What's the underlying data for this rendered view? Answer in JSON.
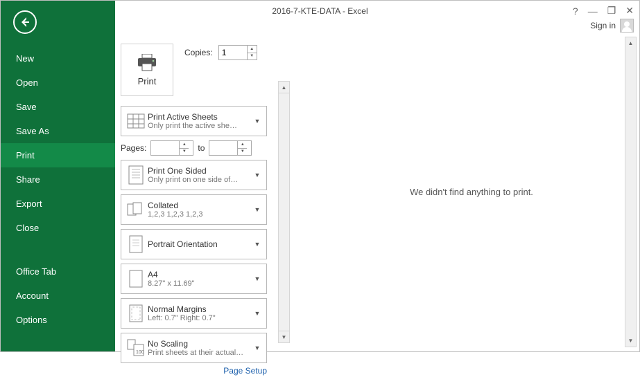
{
  "titlebar": {
    "title": "2016-7-KTE-DATA - Excel",
    "help_glyph": "?",
    "minimize_glyph": "—",
    "restore_glyph": "❐",
    "close_glyph": "✕",
    "signin_label": "Sign in"
  },
  "sidebar": {
    "items": [
      {
        "key": "new",
        "label": "New",
        "active": false
      },
      {
        "key": "open",
        "label": "Open",
        "active": false
      },
      {
        "key": "save",
        "label": "Save",
        "active": false
      },
      {
        "key": "saveas",
        "label": "Save As",
        "active": false
      },
      {
        "key": "print",
        "label": "Print",
        "active": true
      },
      {
        "key": "share",
        "label": "Share",
        "active": false
      },
      {
        "key": "export",
        "label": "Export",
        "active": false
      },
      {
        "key": "close",
        "label": "Close",
        "active": false
      }
    ],
    "lower_items": [
      {
        "key": "officetab",
        "label": "Office Tab"
      },
      {
        "key": "account",
        "label": "Account"
      },
      {
        "key": "options",
        "label": "Options"
      }
    ]
  },
  "print_panel": {
    "print_button_label": "Print",
    "copies_label": "Copies:",
    "copies_value": "1",
    "pages_label": "Pages:",
    "pages_from": "",
    "pages_to_label": "to",
    "pages_to": "",
    "page_setup_link": "Page Setup",
    "settings": [
      {
        "key": "what",
        "title": "Print Active Sheets",
        "sub": "Only print the active she…",
        "icon": "sheets"
      },
      {
        "key": "sides",
        "title": "Print One Sided",
        "sub": "Only print on one side of…",
        "icon": "page"
      },
      {
        "key": "collate",
        "title": "Collated",
        "sub": "1,2,3    1,2,3    1,2,3",
        "icon": "collate"
      },
      {
        "key": "orientation",
        "title": "Portrait Orientation",
        "sub": "",
        "icon": "portrait"
      },
      {
        "key": "paper",
        "title": "A4",
        "sub": "8.27\" x 11.69\"",
        "icon": "paper"
      },
      {
        "key": "margins",
        "title": "Normal Margins",
        "sub": "Left:  0.7\"     Right:  0.7\"",
        "icon": "margins"
      },
      {
        "key": "scaling",
        "title": "No Scaling",
        "sub": "Print sheets at their actual…",
        "icon": "scaling"
      }
    ]
  },
  "preview": {
    "empty_message": "We didn't find anything to print."
  },
  "colors": {
    "brand_green": "#0f713a",
    "brand_green_light": "#138a48"
  }
}
